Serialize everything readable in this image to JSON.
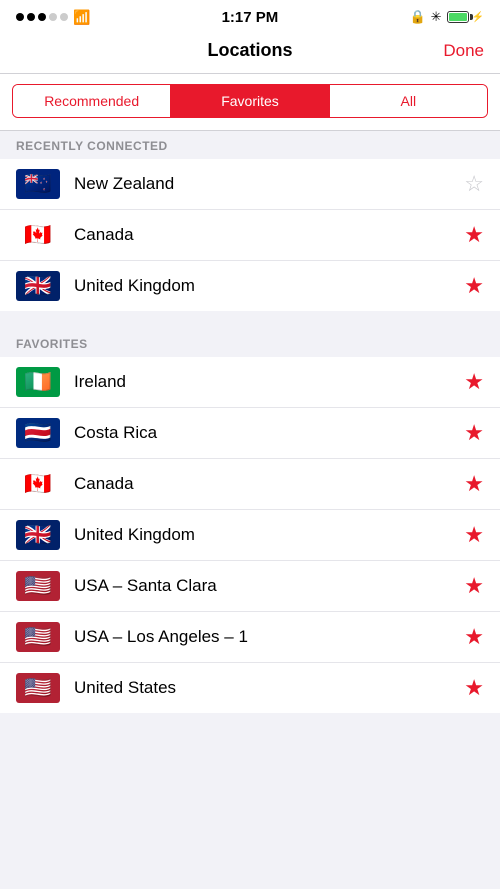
{
  "statusBar": {
    "time": "1:17 PM",
    "signalDots": [
      true,
      true,
      true,
      false,
      false
    ]
  },
  "navBar": {
    "title": "Locations",
    "doneLabel": "Done"
  },
  "segmentControl": {
    "tabs": [
      "Recommended",
      "Favorites",
      "All"
    ],
    "activeIndex": 1
  },
  "recentlyConnected": {
    "sectionHeader": "RECENTLY CONNECTED",
    "items": [
      {
        "country": "New Zealand",
        "flagClass": "flag-nz",
        "starred": false
      },
      {
        "country": "Canada",
        "flagClass": "flag-ca",
        "starred": true
      },
      {
        "country": "United Kingdom",
        "flagClass": "flag-gb",
        "starred": true
      }
    ]
  },
  "favorites": {
    "sectionHeader": "FAVORITES",
    "items": [
      {
        "country": "Ireland",
        "flagClass": "flag-ie",
        "starred": true
      },
      {
        "country": "Costa Rica",
        "flagClass": "flag-cr",
        "starred": true
      },
      {
        "country": "Canada",
        "flagClass": "flag-ca",
        "starred": true
      },
      {
        "country": "United Kingdom",
        "flagClass": "flag-gb",
        "starred": true
      },
      {
        "country": "USA – Santa Clara",
        "flagClass": "flag-us",
        "starred": true
      },
      {
        "country": "USA – Los Angeles – 1",
        "flagClass": "flag-us",
        "starred": true
      },
      {
        "country": "United States",
        "flagClass": "flag-us",
        "starred": true
      }
    ]
  },
  "icons": {
    "starFilled": "★",
    "starEmpty": "☆"
  },
  "colors": {
    "accent": "#e8192c"
  }
}
